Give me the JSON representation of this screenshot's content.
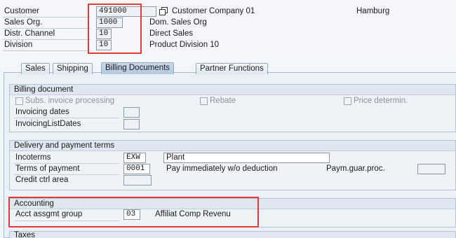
{
  "header": {
    "customer_label": "Customer",
    "customer_value": "491000",
    "customer_name": "Customer Company 01",
    "customer_city": "Hamburg",
    "sales_org_label": "Sales Org.",
    "sales_org_value": "1000",
    "sales_org_desc": "Dom. Sales Org",
    "distr_channel_label": "Distr. Channel",
    "distr_channel_value": "10",
    "distr_channel_desc": "Direct Sales",
    "division_label": "Division",
    "division_value": "10",
    "division_desc": "Product Division 10"
  },
  "tabs": [
    {
      "label": "Sales"
    },
    {
      "label": "Shipping"
    },
    {
      "label": "Billing Documents"
    },
    {
      "label": "Partner Functions"
    }
  ],
  "billing": {
    "title": "Billing document",
    "subs_invoice_label": "Subs. invoice processing",
    "rebate_label": "Rebate",
    "price_determ_label": "Price determin.",
    "invoicing_dates_label": "Invoicing dates",
    "invoicing_list_label": "InvoicingListDates"
  },
  "delivery": {
    "title": "Delivery and payment terms",
    "incoterms_label": "Incoterms",
    "incoterms_value": "EXW",
    "incoterms_desc": "Plant",
    "terms_label": "Terms of payment",
    "terms_value": "0001",
    "terms_desc": "Pay immediately w/o deduction",
    "paym_guar_label": "Paym.guar.proc.",
    "credit_label": "Credit ctrl area"
  },
  "accounting": {
    "title": "Accounting",
    "acct_label": "Acct assgmt group",
    "acct_value": "03",
    "acct_desc": "Affiliat Comp Revenu"
  },
  "taxes": {
    "title": "Taxes"
  },
  "colors": {
    "highlight": "#e03a3a",
    "active_tab": "#b4c9df"
  }
}
